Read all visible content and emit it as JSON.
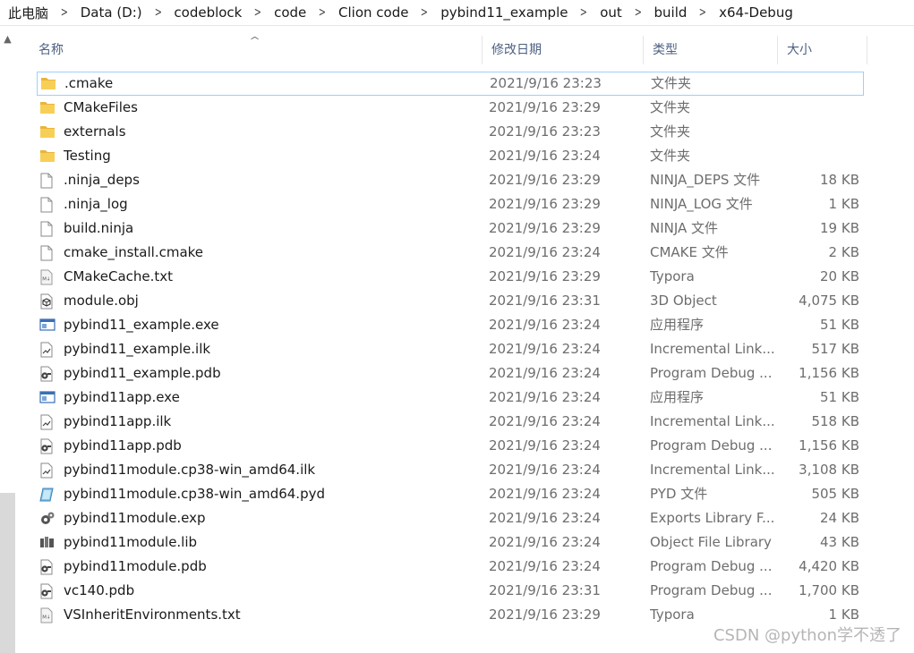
{
  "breadcrumb": [
    "此电脑",
    "Data (D:)",
    "codeblock",
    "code",
    "Clion code",
    "pybind11_example",
    "out",
    "build",
    "x64-Debug"
  ],
  "columns": {
    "name": "名称",
    "date": "修改日期",
    "type": "类型",
    "size": "大小"
  },
  "files": [
    {
      "name": ".cmake",
      "date": "2021/9/16 23:23",
      "type": "文件夹",
      "size": "",
      "icon": "folder-icon",
      "selected": true
    },
    {
      "name": "CMakeFiles",
      "date": "2021/9/16 23:29",
      "type": "文件夹",
      "size": "",
      "icon": "folder-icon"
    },
    {
      "name": "externals",
      "date": "2021/9/16 23:23",
      "type": "文件夹",
      "size": "",
      "icon": "folder-icon"
    },
    {
      "name": "Testing",
      "date": "2021/9/16 23:24",
      "type": "文件夹",
      "size": "",
      "icon": "folder-icon"
    },
    {
      "name": ".ninja_deps",
      "date": "2021/9/16 23:29",
      "type": "NINJA_DEPS 文件",
      "size": "18 KB",
      "icon": "file-icon"
    },
    {
      "name": ".ninja_log",
      "date": "2021/9/16 23:29",
      "type": "NINJA_LOG 文件",
      "size": "1 KB",
      "icon": "file-icon"
    },
    {
      "name": "build.ninja",
      "date": "2021/9/16 23:29",
      "type": "NINJA 文件",
      "size": "19 KB",
      "icon": "file-icon"
    },
    {
      "name": "cmake_install.cmake",
      "date": "2021/9/16 23:24",
      "type": "CMAKE 文件",
      "size": "2 KB",
      "icon": "file-icon"
    },
    {
      "name": "CMakeCache.txt",
      "date": "2021/9/16 23:29",
      "type": "Typora",
      "size": "20 KB",
      "icon": "markdown-file-icon"
    },
    {
      "name": "module.obj",
      "date": "2021/9/16 23:31",
      "type": "3D Object",
      "size": "4,075 KB",
      "icon": "3d-object-icon"
    },
    {
      "name": "pybind11_example.exe",
      "date": "2021/9/16 23:24",
      "type": "应用程序",
      "size": "51 KB",
      "icon": "application-icon"
    },
    {
      "name": "pybind11_example.ilk",
      "date": "2021/9/16 23:24",
      "type": "Incremental Link...",
      "size": "517 KB",
      "icon": "linker-file-icon"
    },
    {
      "name": "pybind11_example.pdb",
      "date": "2021/9/16 23:24",
      "type": "Program Debug ...",
      "size": "1,156 KB",
      "icon": "debug-database-icon"
    },
    {
      "name": "pybind11app.exe",
      "date": "2021/9/16 23:24",
      "type": "应用程序",
      "size": "51 KB",
      "icon": "application-icon"
    },
    {
      "name": "pybind11app.ilk",
      "date": "2021/9/16 23:24",
      "type": "Incremental Link...",
      "size": "518 KB",
      "icon": "linker-file-icon"
    },
    {
      "name": "pybind11app.pdb",
      "date": "2021/9/16 23:24",
      "type": "Program Debug ...",
      "size": "1,156 KB",
      "icon": "debug-database-icon"
    },
    {
      "name": "pybind11module.cp38-win_amd64.ilk",
      "date": "2021/9/16 23:24",
      "type": "Incremental Link...",
      "size": "3,108 KB",
      "icon": "linker-file-icon"
    },
    {
      "name": "pybind11module.cp38-win_amd64.pyd",
      "date": "2021/9/16 23:24",
      "type": "PYD 文件",
      "size": "505 KB",
      "icon": "pyd-file-icon"
    },
    {
      "name": "pybind11module.exp",
      "date": "2021/9/16 23:24",
      "type": "Exports Library F...",
      "size": "24 KB",
      "icon": "exports-library-icon"
    },
    {
      "name": "pybind11module.lib",
      "date": "2021/9/16 23:24",
      "type": "Object File Library",
      "size": "43 KB",
      "icon": "object-library-icon"
    },
    {
      "name": "pybind11module.pdb",
      "date": "2021/9/16 23:24",
      "type": "Program Debug ...",
      "size": "4,420 KB",
      "icon": "debug-database-icon"
    },
    {
      "name": "vc140.pdb",
      "date": "2021/9/16 23:31",
      "type": "Program Debug ...",
      "size": "1,700 KB",
      "icon": "debug-database-icon"
    },
    {
      "name": "VSInheritEnvironments.txt",
      "date": "2021/9/16 23:29",
      "type": "Typora",
      "size": "1 KB",
      "icon": "markdown-file-icon"
    }
  ],
  "watermark": "CSDN @python学不透了",
  "colors": {
    "header_text": "#4d6082",
    "selection_border": "#99d1ff",
    "folder_yellow": "#f8c94a",
    "secondary_text": "#6d6d6d"
  }
}
